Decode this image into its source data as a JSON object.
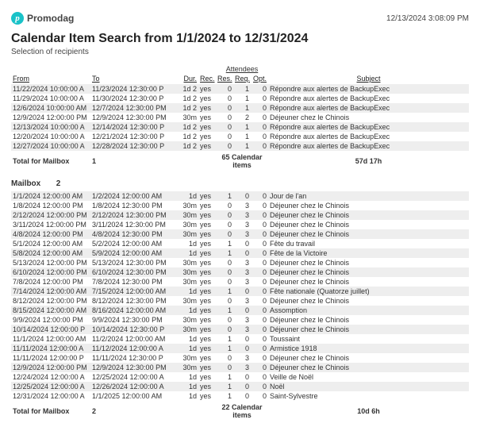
{
  "brand": {
    "mark": "p",
    "name": "Promodag"
  },
  "header": {
    "timestamp": "12/13/2024 3:08:09 PM"
  },
  "title": "Calendar Item Search from 1/1/2024 to 12/31/2024",
  "subtitle": "Selection of recipients",
  "columns": {
    "from": "From",
    "to": "To",
    "dur": "Dur.",
    "rec": "Rec.",
    "attendees_group": "Attendees",
    "res": "Res.",
    "req": "Req.",
    "opt": "Opt.",
    "subject": "Subject"
  },
  "section1": {
    "rows": [
      {
        "from": "11/22/2024 10:00:00 A",
        "to": "11/23/2024 12:30:00 P",
        "dur": "1d 2",
        "rec": "yes",
        "res": "0",
        "req": "1",
        "opt": "0",
        "subject": "Répondre aux alertes de BackupExec"
      },
      {
        "from": "11/29/2024 10:00:00 A",
        "to": "11/30/2024 12:30:00 P",
        "dur": "1d 2",
        "rec": "yes",
        "res": "0",
        "req": "1",
        "opt": "0",
        "subject": "Répondre aux alertes de BackupExec"
      },
      {
        "from": "12/6/2024 10:00:00 AM",
        "to": "12/7/2024 12:30:00 PM",
        "dur": "1d 2",
        "rec": "yes",
        "res": "0",
        "req": "1",
        "opt": "0",
        "subject": "Répondre aux alertes de BackupExec"
      },
      {
        "from": "12/9/2024 12:00:00 PM",
        "to": "12/9/2024 12:30:00 PM",
        "dur": "30m",
        "rec": "yes",
        "res": "0",
        "req": "2",
        "opt": "0",
        "subject": "Déjeuner chez le Chinois"
      },
      {
        "from": "12/13/2024 10:00:00 A",
        "to": "12/14/2024 12:30:00 P",
        "dur": "1d 2",
        "rec": "yes",
        "res": "0",
        "req": "1",
        "opt": "0",
        "subject": "Répondre aux alertes de BackupExec"
      },
      {
        "from": "12/20/2024 10:00:00 A",
        "to": "12/21/2024 12:30:00 P",
        "dur": "1d 2",
        "rec": "yes",
        "res": "0",
        "req": "1",
        "opt": "0",
        "subject": "Répondre aux alertes de BackupExec"
      },
      {
        "from": "12/27/2024 10:00:00 A",
        "to": "12/28/2024 12:30:00 P",
        "dur": "1d 2",
        "rec": "yes",
        "res": "0",
        "req": "1",
        "opt": "0",
        "subject": "Répondre aux alertes de BackupExec"
      }
    ],
    "total": {
      "label": "Total for Mailbox",
      "num": "1",
      "items": "65 Calendar items",
      "dur": "57d 17h"
    }
  },
  "mailbox_heading": {
    "label": "Mailbox",
    "num": "2"
  },
  "section2": {
    "rows": [
      {
        "from": "1/1/2024 12:00:00 AM",
        "to": "1/2/2024 12:00:00 AM",
        "dur": "1d",
        "rec": "yes",
        "res": "1",
        "req": "0",
        "opt": "0",
        "subject": "Jour de l'an"
      },
      {
        "from": "1/8/2024 12:00:00 PM",
        "to": "1/8/2024 12:30:00 PM",
        "dur": "30m",
        "rec": "yes",
        "res": "0",
        "req": "3",
        "opt": "0",
        "subject": "Déjeuner chez le Chinois"
      },
      {
        "from": "2/12/2024 12:00:00 PM",
        "to": "2/12/2024 12:30:00 PM",
        "dur": "30m",
        "rec": "yes",
        "res": "0",
        "req": "3",
        "opt": "0",
        "subject": "Déjeuner chez le Chinois"
      },
      {
        "from": "3/11/2024 12:00:00 PM",
        "to": "3/11/2024 12:30:00 PM",
        "dur": "30m",
        "rec": "yes",
        "res": "0",
        "req": "3",
        "opt": "0",
        "subject": "Déjeuner chez le Chinois"
      },
      {
        "from": "4/8/2024 12:00:00 PM",
        "to": "4/8/2024 12:30:00 PM",
        "dur": "30m",
        "rec": "yes",
        "res": "0",
        "req": "3",
        "opt": "0",
        "subject": "Déjeuner chez le Chinois"
      },
      {
        "from": "5/1/2024 12:00:00 AM",
        "to": "5/2/2024 12:00:00 AM",
        "dur": "1d",
        "rec": "yes",
        "res": "1",
        "req": "0",
        "opt": "0",
        "subject": "Fête du travail"
      },
      {
        "from": "5/8/2024 12:00:00 AM",
        "to": "5/9/2024 12:00:00 AM",
        "dur": "1d",
        "rec": "yes",
        "res": "1",
        "req": "0",
        "opt": "0",
        "subject": "Fête de la Victoire"
      },
      {
        "from": "5/13/2024 12:00:00 PM",
        "to": "5/13/2024 12:30:00 PM",
        "dur": "30m",
        "rec": "yes",
        "res": "0",
        "req": "3",
        "opt": "0",
        "subject": "Déjeuner chez le Chinois"
      },
      {
        "from": "6/10/2024 12:00:00 PM",
        "to": "6/10/2024 12:30:00 PM",
        "dur": "30m",
        "rec": "yes",
        "res": "0",
        "req": "3",
        "opt": "0",
        "subject": "Déjeuner chez le Chinois"
      },
      {
        "from": "7/8/2024 12:00:00 PM",
        "to": "7/8/2024 12:30:00 PM",
        "dur": "30m",
        "rec": "yes",
        "res": "0",
        "req": "3",
        "opt": "0",
        "subject": "Déjeuner chez le Chinois"
      },
      {
        "from": "7/14/2024 12:00:00 AM",
        "to": "7/15/2024 12:00:00 AM",
        "dur": "1d",
        "rec": "yes",
        "res": "1",
        "req": "0",
        "opt": "0",
        "subject": "Fête nationale (Quatorze juillet)"
      },
      {
        "from": "8/12/2024 12:00:00 PM",
        "to": "8/12/2024 12:30:00 PM",
        "dur": "30m",
        "rec": "yes",
        "res": "0",
        "req": "3",
        "opt": "0",
        "subject": "Déjeuner chez le Chinois"
      },
      {
        "from": "8/15/2024 12:00:00 AM",
        "to": "8/16/2024 12:00:00 AM",
        "dur": "1d",
        "rec": "yes",
        "res": "1",
        "req": "0",
        "opt": "0",
        "subject": "Assomption"
      },
      {
        "from": "9/9/2024 12:00:00 PM",
        "to": "9/9/2024 12:30:00 PM",
        "dur": "30m",
        "rec": "yes",
        "res": "0",
        "req": "3",
        "opt": "0",
        "subject": "Déjeuner chez le Chinois"
      },
      {
        "from": "10/14/2024 12:00:00 P",
        "to": "10/14/2024 12:30:00 P",
        "dur": "30m",
        "rec": "yes",
        "res": "0",
        "req": "3",
        "opt": "0",
        "subject": "Déjeuner chez le Chinois"
      },
      {
        "from": "11/1/2024 12:00:00 AM",
        "to": "11/2/2024 12:00:00 AM",
        "dur": "1d",
        "rec": "yes",
        "res": "1",
        "req": "0",
        "opt": "0",
        "subject": "Toussaint"
      },
      {
        "from": "11/11/2024 12:00:00 A",
        "to": "11/12/2024 12:00:00 A",
        "dur": "1d",
        "rec": "yes",
        "res": "1",
        "req": "0",
        "opt": "0",
        "subject": "Armistice 1918"
      },
      {
        "from": "11/11/2024 12:00:00 P",
        "to": "11/11/2024 12:30:00 P",
        "dur": "30m",
        "rec": "yes",
        "res": "0",
        "req": "3",
        "opt": "0",
        "subject": "Déjeuner chez le Chinois"
      },
      {
        "from": "12/9/2024 12:00:00 PM",
        "to": "12/9/2024 12:30:00 PM",
        "dur": "30m",
        "rec": "yes",
        "res": "0",
        "req": "3",
        "opt": "0",
        "subject": "Déjeuner chez le Chinois"
      },
      {
        "from": "12/24/2024 12:00:00 A",
        "to": "12/25/2024 12:00:00 A",
        "dur": "1d",
        "rec": "yes",
        "res": "1",
        "req": "0",
        "opt": "0",
        "subject": "Veille de Noël"
      },
      {
        "from": "12/25/2024 12:00:00 A",
        "to": "12/26/2024 12:00:00 A",
        "dur": "1d",
        "rec": "yes",
        "res": "1",
        "req": "0",
        "opt": "0",
        "subject": "Noël"
      },
      {
        "from": "12/31/2024 12:00:00 A",
        "to": "1/1/2025 12:00:00 AM",
        "dur": "1d",
        "rec": "yes",
        "res": "1",
        "req": "0",
        "opt": "0",
        "subject": "Saint-Sylvestre"
      }
    ],
    "total": {
      "label": "Total for Mailbox",
      "num": "2",
      "items": "22 Calendar items",
      "dur": "10d 6h"
    }
  }
}
